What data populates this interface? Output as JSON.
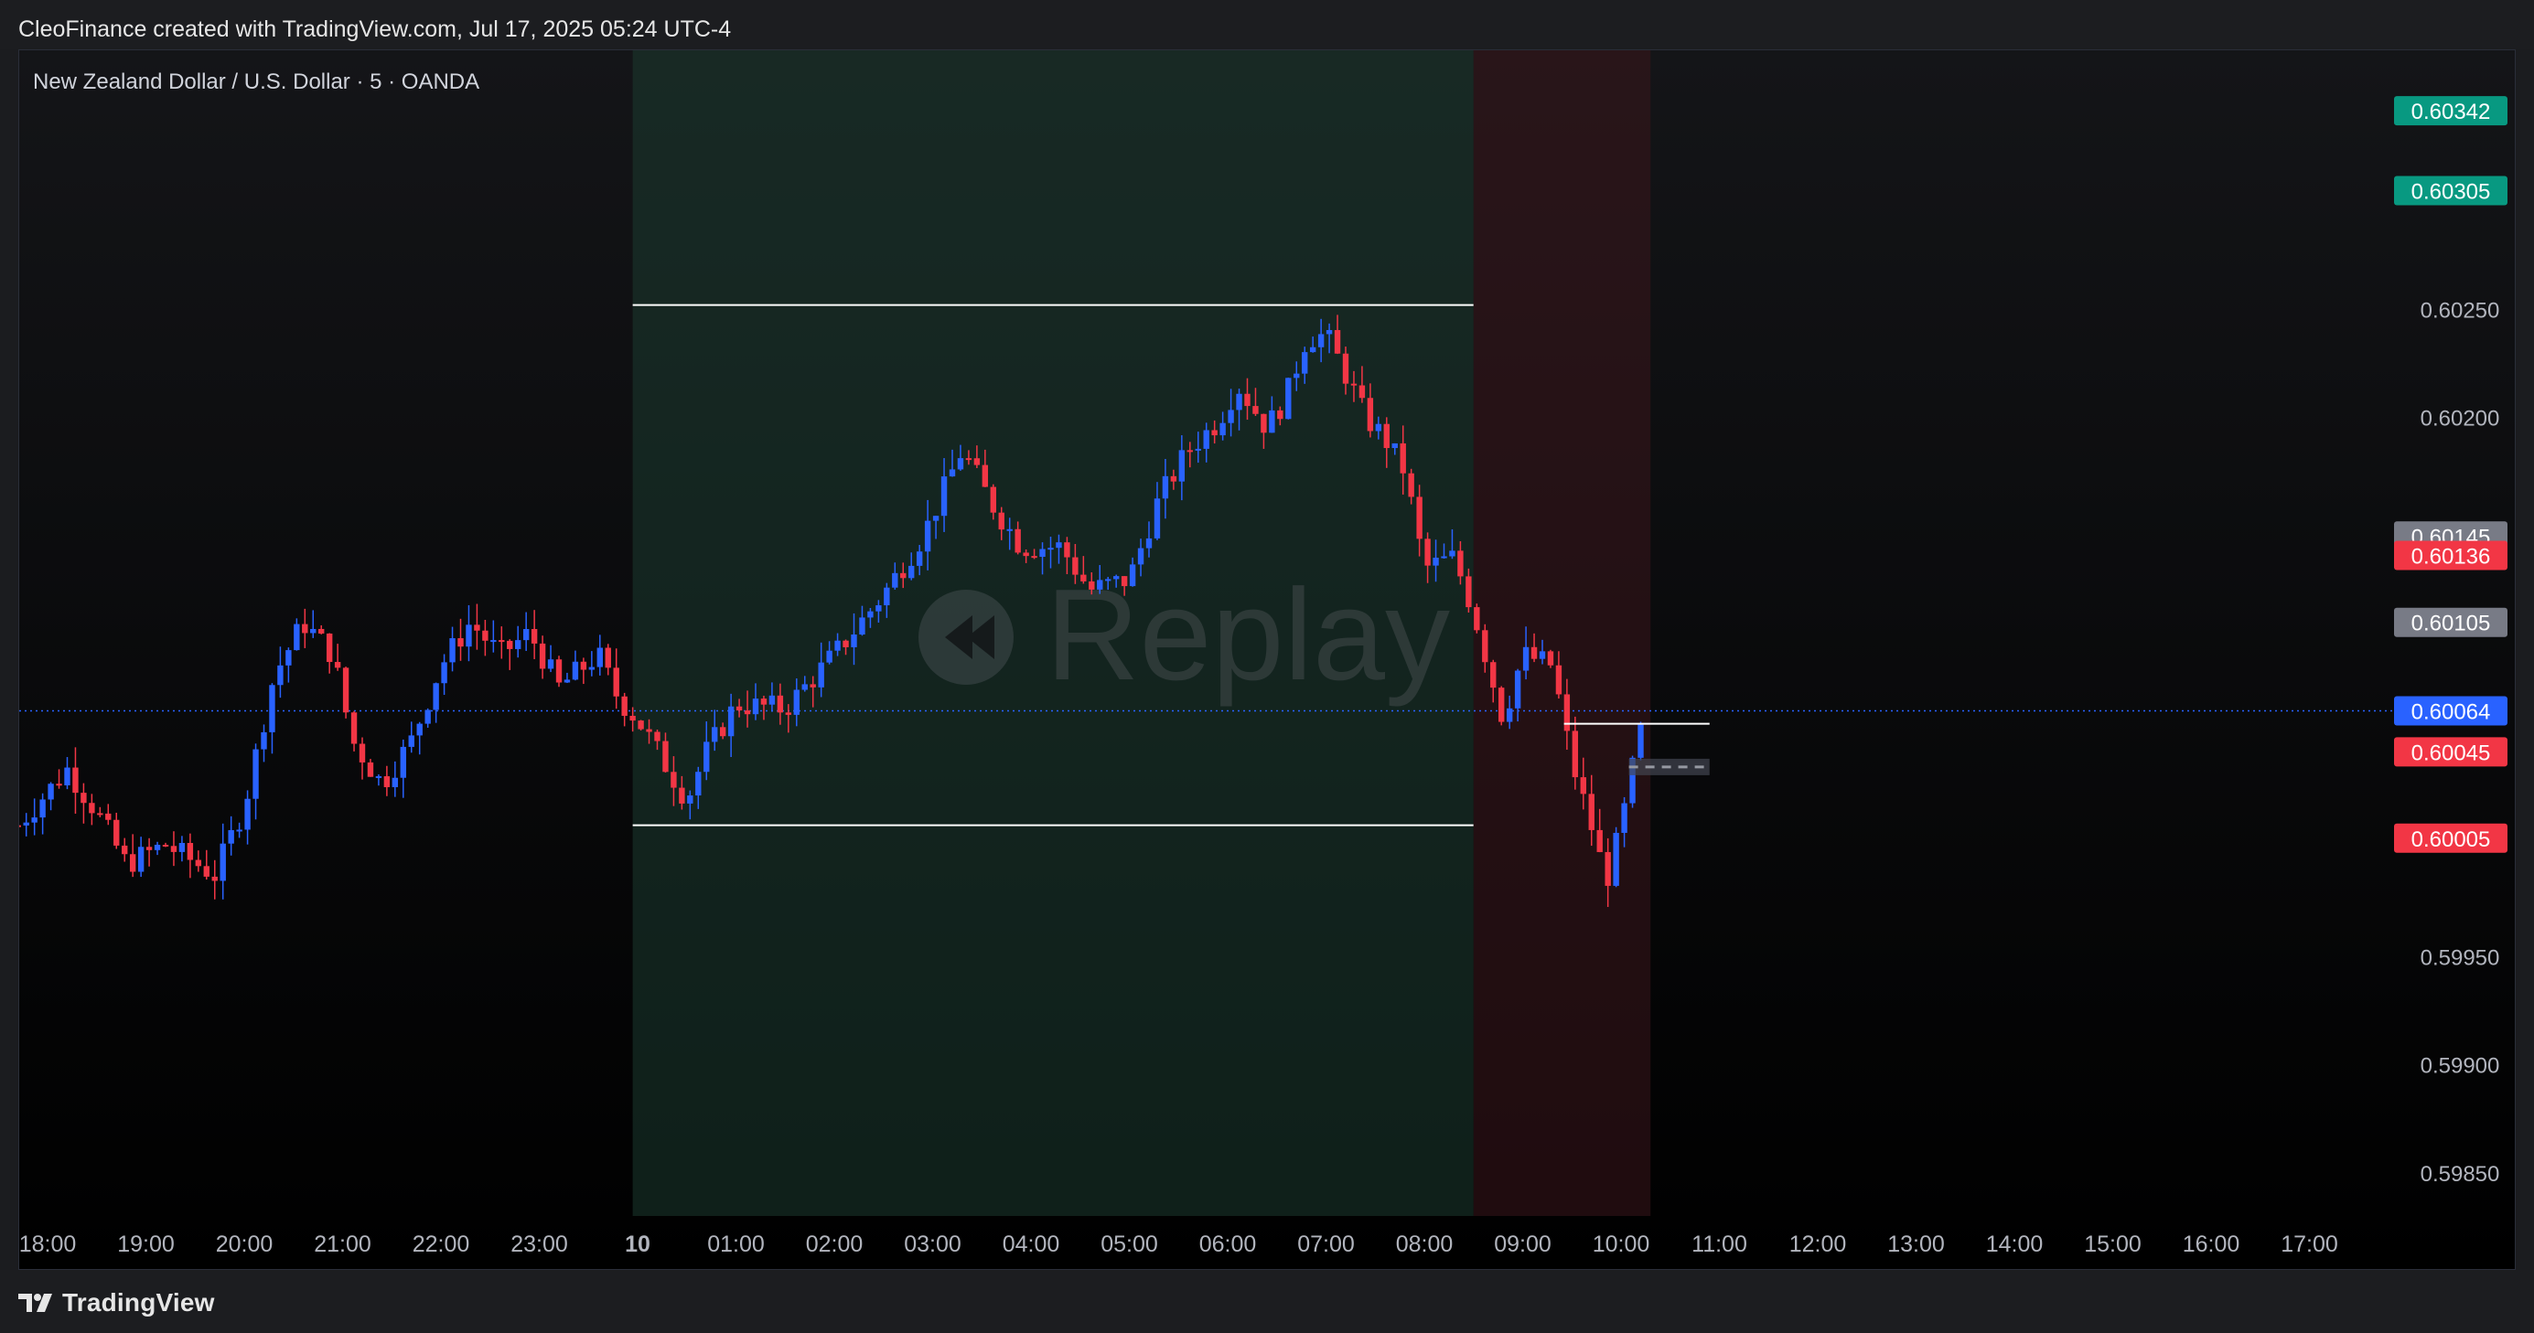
{
  "header": {
    "attribution": "CleoFinance created with TradingView.com, Jul 17, 2025 05:24 UTC-4"
  },
  "symbol_info": "New Zealand Dollar / U.S. Dollar · 5 · OANDA",
  "watermark": "Replay",
  "footer": {
    "brand": "TradingView"
  },
  "colors": {
    "background_top": "#141518",
    "background_bottom": "#000000",
    "up_candle": "#2962ff",
    "down_candle": "#f23645",
    "range_box_green": "#1b3a2f",
    "range_box_red": "#3a151c",
    "range_lines": "#ffffff",
    "price_line": "#2962ff"
  },
  "chart_data": {
    "type": "candlestick",
    "ylim": [
      0.5983,
      0.6037
    ],
    "y_ticks": [
      "0.60250",
      "0.60200",
      "0.59950",
      "0.59900",
      "0.59850"
    ],
    "x_ticks": [
      {
        "hour": -6,
        "label": "18:00"
      },
      {
        "hour": -5,
        "label": "19:00"
      },
      {
        "hour": -4,
        "label": "20:00"
      },
      {
        "hour": -3,
        "label": "21:00"
      },
      {
        "hour": -2,
        "label": "22:00"
      },
      {
        "hour": -1,
        "label": "23:00"
      },
      {
        "hour": 0,
        "label": "10"
      },
      {
        "hour": 1,
        "label": "01:00"
      },
      {
        "hour": 2,
        "label": "02:00"
      },
      {
        "hour": 3,
        "label": "03:00"
      },
      {
        "hour": 4,
        "label": "04:00"
      },
      {
        "hour": 5,
        "label": "05:00"
      },
      {
        "hour": 6,
        "label": "06:00"
      },
      {
        "hour": 7,
        "label": "07:00"
      },
      {
        "hour": 8,
        "label": "08:00"
      },
      {
        "hour": 9,
        "label": "09:00"
      },
      {
        "hour": 10,
        "label": "10:00"
      },
      {
        "hour": 11,
        "label": "11:00"
      },
      {
        "hour": 12,
        "label": "12:00"
      },
      {
        "hour": 13,
        "label": "13:00"
      },
      {
        "hour": 14,
        "label": "14:00"
      },
      {
        "hour": 15,
        "label": "15:00"
      },
      {
        "hour": 16,
        "label": "16:00"
      },
      {
        "hour": 17,
        "label": "17:00"
      }
    ],
    "price_labels": [
      {
        "value": "0.60342",
        "price": 0.60342,
        "color": "#089981"
      },
      {
        "value": "0.60305",
        "price": 0.60305,
        "color": "#089981"
      },
      {
        "value": "0.60145",
        "price": 0.60145,
        "color": "#787b86"
      },
      {
        "value": "0.60136",
        "price": 0.60136,
        "color": "#f23645"
      },
      {
        "value": "0.60105",
        "price": 0.60105,
        "color": "#787b86"
      },
      {
        "value": "0.60064",
        "price": 0.60064,
        "color": "#2962ff"
      },
      {
        "value": "0.60045",
        "price": 0.60045,
        "color": "#f23645"
      },
      {
        "value": "0.60005",
        "price": 0.60005,
        "color": "#f23645"
      }
    ],
    "current_price": 0.60064,
    "zones": [
      {
        "kind": "asia-range",
        "start_hour": -0.05,
        "end_hour": 8.5,
        "high": 0.60252,
        "low": 0.60011
      },
      {
        "kind": "london-open",
        "start_hour": 8.5,
        "end_hour": 10.3
      }
    ],
    "lines": [
      {
        "start_hour": 9.42,
        "end_hour": 10.9,
        "price": 0.60058,
        "style": "solid"
      },
      {
        "start_hour": 10.08,
        "end_hour": 10.9,
        "price": 0.60038,
        "style": "dashed"
      }
    ],
    "series_anchors": [
      [
        -6.3,
        0.60011
      ],
      [
        -5.8,
        0.60037
      ],
      [
        -5.5,
        0.60017
      ],
      [
        -5.2,
        0.59993
      ],
      [
        -4.8,
        0.60002
      ],
      [
        -4.3,
        0.59988
      ],
      [
        -4.0,
        0.6002
      ],
      [
        -3.7,
        0.6008
      ],
      [
        -3.4,
        0.60105
      ],
      [
        -3.1,
        0.6009
      ],
      [
        -2.9,
        0.6005
      ],
      [
        -2.6,
        0.6003
      ],
      [
        -2.3,
        0.6005
      ],
      [
        -2.0,
        0.60085
      ],
      [
        -1.7,
        0.60105
      ],
      [
        -1.4,
        0.6009
      ],
      [
        -1.1,
        0.601
      ],
      [
        -0.8,
        0.60075
      ],
      [
        -0.4,
        0.6009
      ],
      [
        -0.2,
        0.6007
      ],
      [
        0.0,
        0.6006
      ],
      [
        0.5,
        0.60023
      ],
      [
        0.7,
        0.60045
      ],
      [
        1.0,
        0.60067
      ],
      [
        1.5,
        0.60065
      ],
      [
        2.0,
        0.6009
      ],
      [
        2.5,
        0.60118
      ],
      [
        2.9,
        0.60145
      ],
      [
        3.3,
        0.60185
      ],
      [
        3.6,
        0.6016
      ],
      [
        3.9,
        0.6014
      ],
      [
        4.3,
        0.6014
      ],
      [
        4.6,
        0.6012
      ],
      [
        5.0,
        0.60125
      ],
      [
        5.3,
        0.60162
      ],
      [
        5.6,
        0.60185
      ],
      [
        5.9,
        0.60198
      ],
      [
        6.1,
        0.60215
      ],
      [
        6.4,
        0.60195
      ],
      [
        6.6,
        0.6021
      ],
      [
        6.8,
        0.60237
      ],
      [
        7.0,
        0.60238
      ],
      [
        7.2,
        0.6022
      ],
      [
        7.4,
        0.602
      ],
      [
        7.6,
        0.6019
      ],
      [
        7.8,
        0.60175
      ],
      [
        8.0,
        0.6013
      ],
      [
        8.3,
        0.60135
      ],
      [
        8.5,
        0.6011
      ],
      [
        8.8,
        0.6006
      ],
      [
        9.0,
        0.6009
      ],
      [
        9.3,
        0.60085
      ],
      [
        9.5,
        0.6004
      ],
      [
        9.7,
        0.6001
      ],
      [
        9.85,
        0.59985
      ],
      [
        10.0,
        0.6001
      ],
      [
        10.12,
        0.60038
      ],
      [
        10.25,
        0.60064
      ]
    ]
  }
}
